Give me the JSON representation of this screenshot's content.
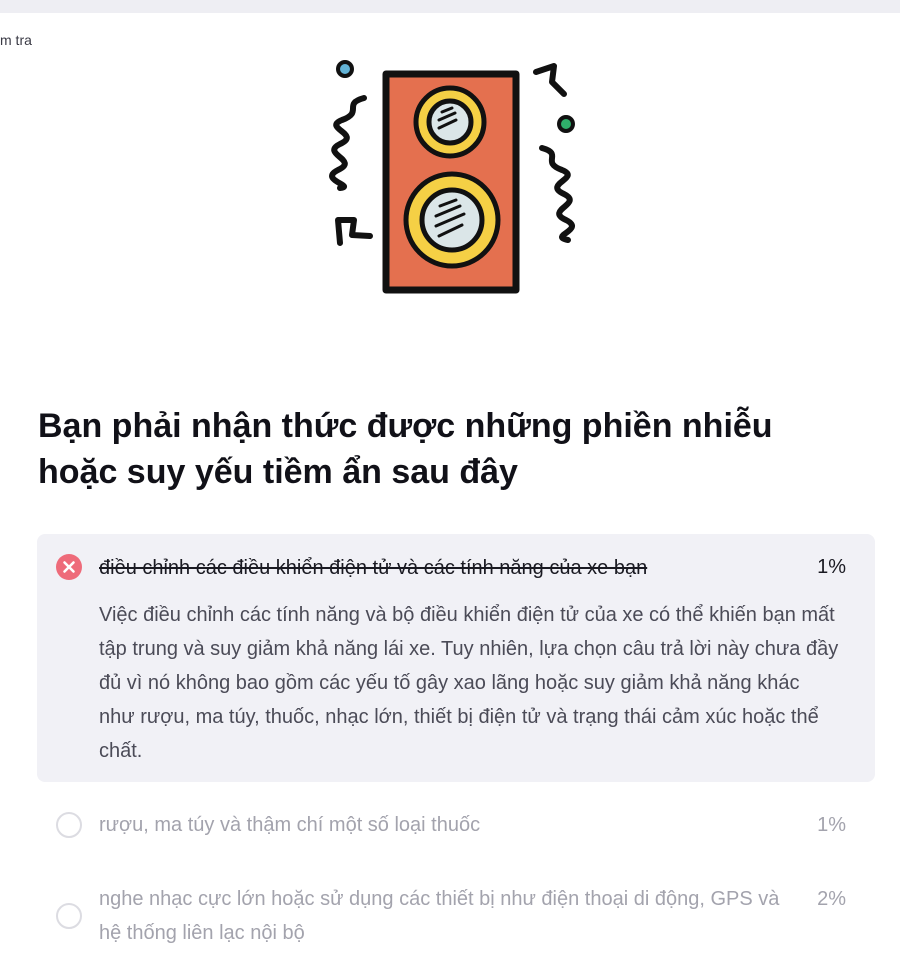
{
  "header": {
    "breadcrumb": "m tra"
  },
  "illustration": {
    "icon": "speaker-icon",
    "colors": {
      "cabinet": "#e4704f",
      "ring": "#f5d045",
      "cone": "#dbe6e8",
      "outline": "#111111",
      "dot_left": "#63b3d6",
      "dot_right": "#2fae6a"
    }
  },
  "question": {
    "title": "Bạn phải nhận thức được những phiền nhiễu hoặc suy yếu tiềm ẩn sau đây"
  },
  "answers": [
    {
      "label": "điều chỉnh các điều khiển điện tử và các tính năng của xe bạn",
      "percent": "1%",
      "state": "selected-incorrect",
      "explanation": "Việc điều chỉnh các tính năng và bộ điều khiển điện tử của xe có thể khiến bạn mất tập trung và suy giảm khả năng lái xe. Tuy nhiên, lựa chọn câu trả lời này chưa đầy đủ vì nó không bao gồm các yếu tố gây xao lãng hoặc suy giảm khả năng khác như rượu, ma túy, thuốc, nhạc lớn, thiết bị điện tử và trạng thái cảm xúc hoặc thể chất."
    },
    {
      "label": "rượu, ma túy và thậm chí một số loại thuốc",
      "percent": "1%",
      "state": "unselected"
    },
    {
      "label": "nghe nhạc cực lớn hoặc sử dụng các thiết bị như điện thoại di động, GPS và hệ thống liên lạc nội bộ",
      "percent": "2%",
      "state": "unselected"
    }
  ],
  "colors": {
    "wrong": "#ee6b7a",
    "selected_bg": "#f1f1f6",
    "muted_text": "#a3a3ad"
  }
}
